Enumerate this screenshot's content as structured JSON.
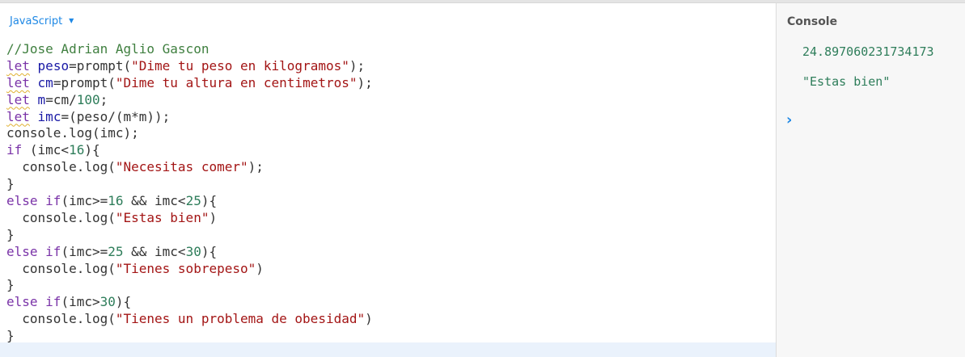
{
  "editor": {
    "language": "JavaScript",
    "lines": [
      [
        {
          "t": "comment",
          "v": "//Jose Adrian Aglio Gascon"
        }
      ],
      [
        {
          "t": "kw-squig",
          "v": "let"
        },
        {
          "t": "plain",
          "v": " "
        },
        {
          "t": "var",
          "v": "peso"
        },
        {
          "t": "plain",
          "v": "=prompt("
        },
        {
          "t": "str",
          "v": "\"Dime tu peso en kilogramos\""
        },
        {
          "t": "plain",
          "v": ");"
        }
      ],
      [
        {
          "t": "kw-squig",
          "v": "let"
        },
        {
          "t": "plain",
          "v": " "
        },
        {
          "t": "var",
          "v": "cm"
        },
        {
          "t": "plain",
          "v": "=prompt("
        },
        {
          "t": "str",
          "v": "\"Dime tu altura en centimetros\""
        },
        {
          "t": "plain",
          "v": ");"
        }
      ],
      [
        {
          "t": "kw-squig",
          "v": "let"
        },
        {
          "t": "plain",
          "v": " "
        },
        {
          "t": "var",
          "v": "m"
        },
        {
          "t": "plain",
          "v": "=cm/"
        },
        {
          "t": "num",
          "v": "100"
        },
        {
          "t": "plain",
          "v": ";"
        }
      ],
      [
        {
          "t": "kw-squig",
          "v": "let"
        },
        {
          "t": "plain",
          "v": " "
        },
        {
          "t": "var",
          "v": "imc"
        },
        {
          "t": "plain",
          "v": "=(peso/(m*m));"
        }
      ],
      [
        {
          "t": "plain",
          "v": "console.log(imc);"
        }
      ],
      [
        {
          "t": "kw",
          "v": "if"
        },
        {
          "t": "plain",
          "v": " (imc<"
        },
        {
          "t": "num",
          "v": "16"
        },
        {
          "t": "plain",
          "v": "){"
        }
      ],
      [
        {
          "t": "plain",
          "v": "  console.log("
        },
        {
          "t": "str",
          "v": "\"Necesitas comer\""
        },
        {
          "t": "plain",
          "v": ");"
        }
      ],
      [
        {
          "t": "plain",
          "v": "}"
        }
      ],
      [
        {
          "t": "kw",
          "v": "else if"
        },
        {
          "t": "plain",
          "v": "(imc>="
        },
        {
          "t": "num",
          "v": "16"
        },
        {
          "t": "plain",
          "v": " && imc<"
        },
        {
          "t": "num",
          "v": "25"
        },
        {
          "t": "plain",
          "v": "){"
        }
      ],
      [
        {
          "t": "plain",
          "v": "  console.log("
        },
        {
          "t": "str",
          "v": "\"Estas bien\""
        },
        {
          "t": "plain",
          "v": ")"
        }
      ],
      [
        {
          "t": "plain",
          "v": "}"
        }
      ],
      [
        {
          "t": "kw",
          "v": "else if"
        },
        {
          "t": "plain",
          "v": "(imc>="
        },
        {
          "t": "num",
          "v": "25"
        },
        {
          "t": "plain",
          "v": " && imc<"
        },
        {
          "t": "num",
          "v": "30"
        },
        {
          "t": "plain",
          "v": "){"
        }
      ],
      [
        {
          "t": "plain",
          "v": "  console.log("
        },
        {
          "t": "str",
          "v": "\"Tienes sobrepeso\""
        },
        {
          "t": "plain",
          "v": ")"
        }
      ],
      [
        {
          "t": "plain",
          "v": "}"
        }
      ],
      [
        {
          "t": "kw",
          "v": "else if"
        },
        {
          "t": "plain",
          "v": "(imc>"
        },
        {
          "t": "num",
          "v": "30"
        },
        {
          "t": "plain",
          "v": "){"
        }
      ],
      [
        {
          "t": "plain",
          "v": "  console.log("
        },
        {
          "t": "str",
          "v": "\"Tienes un problema de obesidad\""
        },
        {
          "t": "plain",
          "v": ")"
        }
      ],
      [
        {
          "t": "plain",
          "v": "}"
        }
      ]
    ]
  },
  "console": {
    "title": "Console",
    "outputs": [
      "24.897060231734173",
      "\"Estas bien\""
    ],
    "prompt_icon": "chevron-right-icon",
    "prompt_glyph": "›"
  },
  "colors": {
    "accent": "#1e88e5",
    "string": "#a31515",
    "keyword": "#7a33a8",
    "number": "#2e7d5a",
    "comment": "#3f7f3f"
  }
}
